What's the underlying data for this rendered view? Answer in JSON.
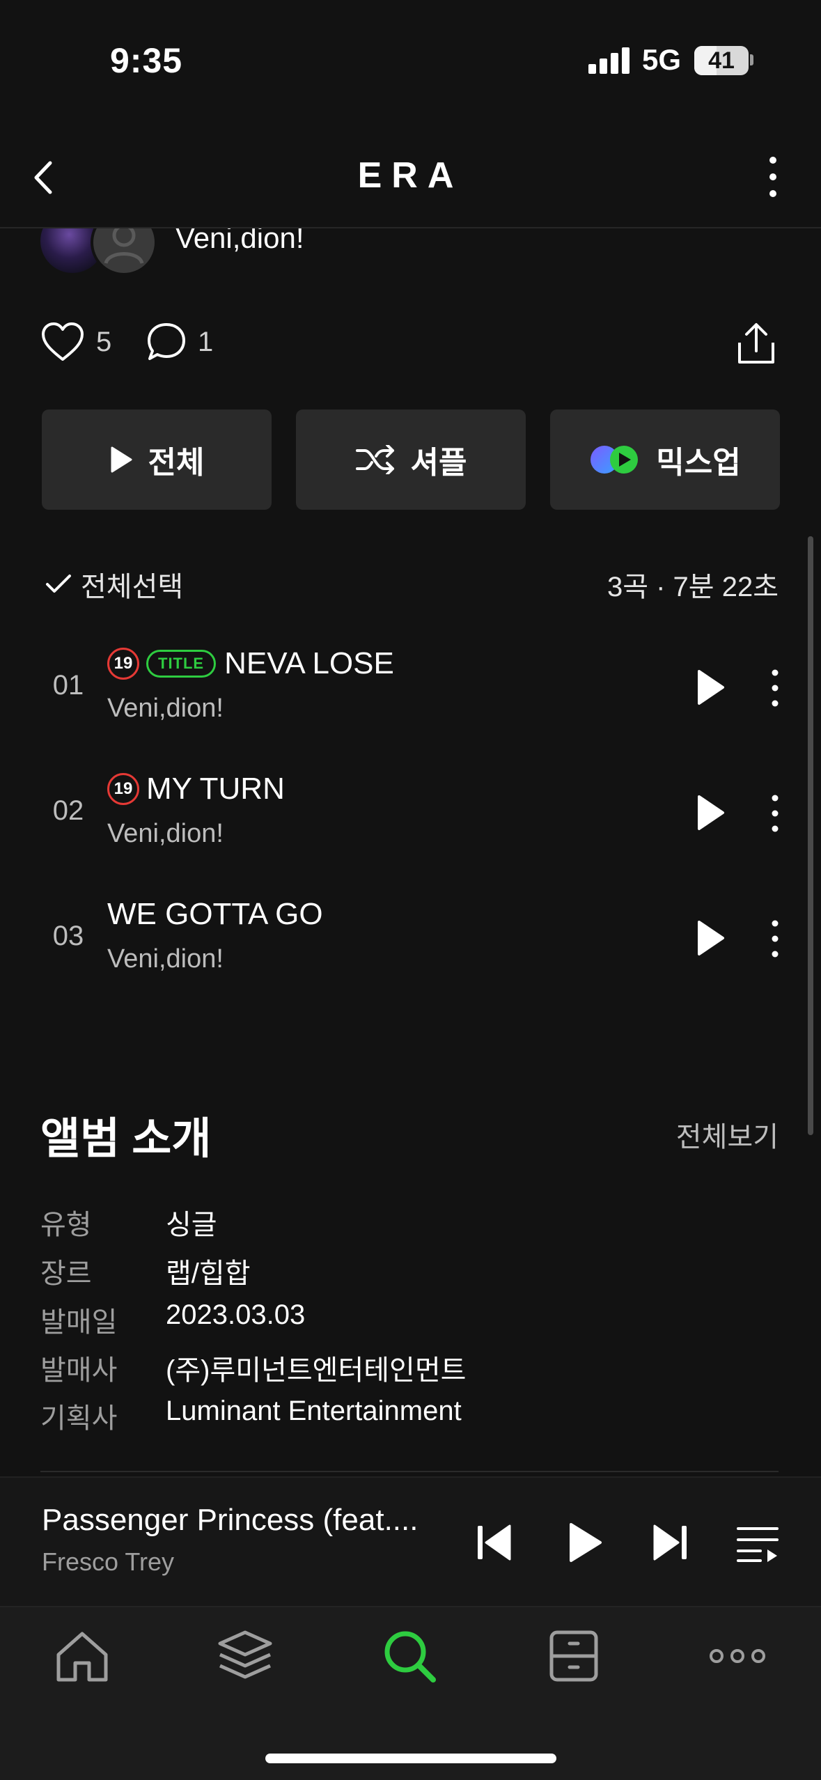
{
  "status": {
    "time": "9:35",
    "network": "5G",
    "battery": "41",
    "battery_level": 0.41
  },
  "header": {
    "title": "ERA"
  },
  "artist": {
    "name": "Veni,dion!"
  },
  "stats": {
    "likes": "5",
    "comments": "1"
  },
  "buttons": {
    "play_all": "전체",
    "shuffle": "셔플",
    "mixup": "믹스업"
  },
  "list": {
    "select_all": "전체선택",
    "meta": "3곡 · 7분 22초"
  },
  "tracks": [
    {
      "num": "01",
      "title": "NEVA LOSE",
      "artist": "Veni,dion!",
      "explicit": true,
      "explicit_label": "19",
      "title_track": true,
      "title_label": "TITLE"
    },
    {
      "num": "02",
      "title": "MY TURN",
      "artist": "Veni,dion!",
      "explicit": true,
      "explicit_label": "19",
      "title_track": false
    },
    {
      "num": "03",
      "title": "WE GOTTA GO",
      "artist": "Veni,dion!",
      "explicit": false,
      "title_track": false
    }
  ],
  "intro": {
    "heading": "앨범 소개",
    "view_all": "전체보기",
    "rows": [
      {
        "key": "유형",
        "value": "싱글"
      },
      {
        "key": "장르",
        "value": "랩/힙합"
      },
      {
        "key": "발매일",
        "value": "2023.03.03"
      },
      {
        "key": "발매사",
        "value": "(주)루미넌트엔터테인먼트"
      },
      {
        "key": "기획사",
        "value": "Luminant Entertainment"
      }
    ]
  },
  "now_playing": {
    "title": "Passenger Princess (feat....",
    "artist": "Fresco Trey"
  },
  "colors": {
    "accent": "#2ecc40",
    "explicit": "#e53935",
    "background": "#121212"
  },
  "tabs": [
    "home-icon",
    "layers-icon",
    "search-icon",
    "storage-icon",
    "more-icon"
  ],
  "active_tab": "search-icon"
}
